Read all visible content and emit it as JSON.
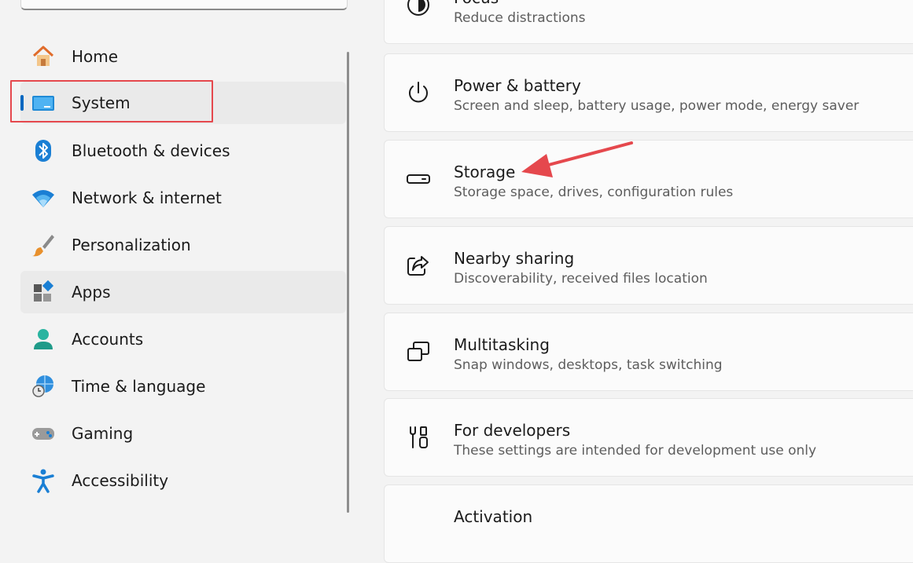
{
  "sidebar": {
    "items": [
      {
        "label": "Home",
        "icon": "home-icon"
      },
      {
        "label": "System",
        "icon": "monitor-icon"
      },
      {
        "label": "Bluetooth & devices",
        "icon": "bluetooth-icon"
      },
      {
        "label": "Network & internet",
        "icon": "wifi-icon"
      },
      {
        "label": "Personalization",
        "icon": "brush-icon"
      },
      {
        "label": "Apps",
        "icon": "apps-icon"
      },
      {
        "label": "Accounts",
        "icon": "person-icon"
      },
      {
        "label": "Time & language",
        "icon": "globe-clock-icon"
      },
      {
        "label": "Gaming",
        "icon": "gamepad-icon"
      },
      {
        "label": "Accessibility",
        "icon": "accessibility-icon"
      }
    ]
  },
  "main": {
    "cards": [
      {
        "title": "Focus",
        "desc": "Reduce distractions",
        "icon": "focus-icon"
      },
      {
        "title": "Power & battery",
        "desc": "Screen and sleep, battery usage, power mode, energy saver",
        "icon": "power-icon"
      },
      {
        "title": "Storage",
        "desc": "Storage space, drives, configuration rules",
        "icon": "storage-icon"
      },
      {
        "title": "Nearby sharing",
        "desc": "Discoverability, received files location",
        "icon": "share-icon"
      },
      {
        "title": "Multitasking",
        "desc": "Snap windows, desktops, task switching",
        "icon": "multitasking-icon"
      },
      {
        "title": "For developers",
        "desc": "These settings are intended for development use only",
        "icon": "developer-tools-icon"
      },
      {
        "title": "Activation",
        "desc": "",
        "icon": "activation-icon"
      }
    ]
  },
  "colors": {
    "accent": "#0067c0",
    "annotation": "#e5484d"
  }
}
